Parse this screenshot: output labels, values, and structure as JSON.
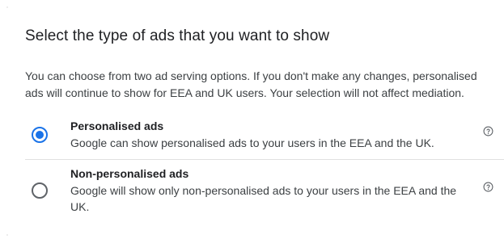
{
  "section": {
    "title": "Select the type of ads that you want to show",
    "description": "You can choose from two ad serving options. If you don't make any changes, personalised ads will continue to show for EEA and UK users. Your selection will not affect mediation."
  },
  "options": [
    {
      "title": "Personalised ads",
      "description": "Google can show personalised ads to your users in the EEA and the UK.",
      "selected": true,
      "help_icon": "help-circle-icon"
    },
    {
      "title": "Non-personalised ads",
      "description": "Google will show only non-personalised ads to your users in the EEA and the UK.",
      "selected": false,
      "help_icon": "help-circle-icon"
    }
  ],
  "colors": {
    "accent": "#1a73e8",
    "text_primary": "#202124",
    "text_secondary": "#3c4043",
    "radio_unselected": "#5f6368",
    "divider": "#e0e0e0"
  }
}
